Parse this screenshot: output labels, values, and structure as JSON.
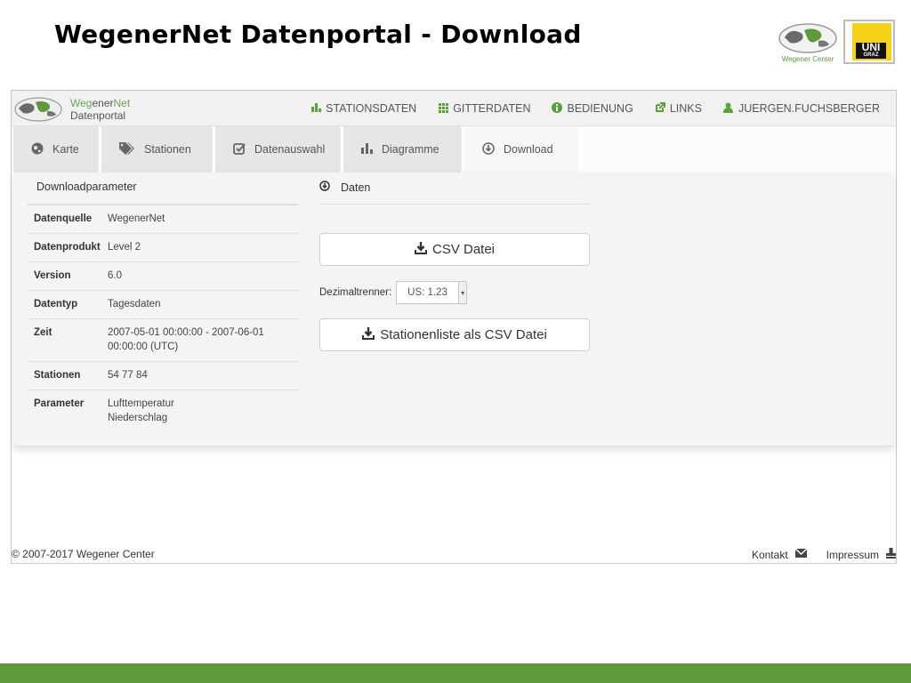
{
  "slide": {
    "title": "WegenerNet Datenportal - Download"
  },
  "logos": {
    "wegener_center": "Wegener Center",
    "uni_top": "UNI",
    "uni_bottom": "GRAZ"
  },
  "brand": {
    "name_part1": "Weg",
    "name_part2": "ener",
    "name_part3": "Net",
    "subtitle": "Datenportal"
  },
  "nav": {
    "items": [
      {
        "icon": "bar-chart-icon",
        "label": "STATIONSDATEN"
      },
      {
        "icon": "grid-icon",
        "label": "GITTERDATEN"
      },
      {
        "icon": "info-icon",
        "label": "BEDIENUNG"
      },
      {
        "icon": "external-link-icon",
        "label": "LINKS"
      },
      {
        "icon": "user-icon",
        "label": "JUERGEN.FUCHSBERGER"
      }
    ]
  },
  "tabs": [
    {
      "icon": "globe-icon",
      "label": "Karte"
    },
    {
      "icon": "tags-icon",
      "label": "Stationen"
    },
    {
      "icon": "check-icon",
      "label": "Datenauswahl"
    },
    {
      "icon": "bar-chart-icon",
      "label": "Diagramme"
    },
    {
      "icon": "download-circle-icon",
      "label": "Download",
      "active": true
    }
  ],
  "params": {
    "heading": "Downloadparameter",
    "rows": [
      {
        "key": "Datenquelle",
        "value": "WegenerNet"
      },
      {
        "key": "Datenprodukt",
        "value": "Level 2"
      },
      {
        "key": "Version",
        "value": "6.0"
      },
      {
        "key": "Datentyp",
        "value": "Tagesdaten"
      },
      {
        "key": "Zeit",
        "value_line1": "2007-05-01 00:00:00 - 2007-06-01",
        "value_line2": "00:00:00 (UTC)"
      },
      {
        "key": "Stationen",
        "value": "54 77 84"
      },
      {
        "key": "Parameter",
        "value_line1": "Lufttemperatur",
        "value_line2": "Niederschlag"
      }
    ]
  },
  "daten": {
    "heading": "Daten",
    "csv_button": "CSV Datei",
    "dezimal_label": "Dezimaltrenner:",
    "dezimal_value": "US: 1.23",
    "stations_button": "Stationenliste als CSV Datei"
  },
  "footer": {
    "copyright": "© 2007-2017 Wegener Center",
    "kontakt": "Kontakt",
    "impressum": "Impressum"
  },
  "colors": {
    "accent_green": "#5c9a3a",
    "brand_green": "#6aa84f",
    "uni_yellow": "#f7d117"
  }
}
